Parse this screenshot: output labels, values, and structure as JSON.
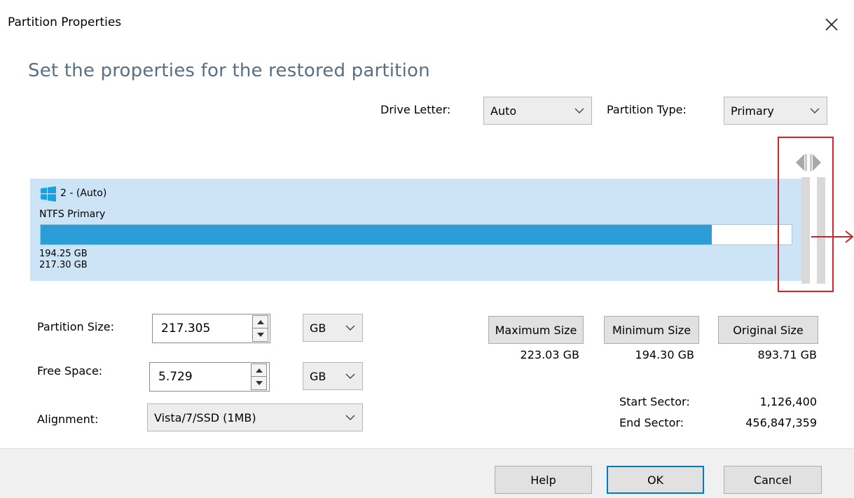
{
  "window": {
    "title": "Partition Properties",
    "close_label": "×"
  },
  "heading": "Set the properties for the restored partition",
  "drive_letter": {
    "label": "Drive Letter:",
    "value": "Auto"
  },
  "partition_type": {
    "label": "Partition Type:",
    "value": "Primary"
  },
  "partition": {
    "name": "2 -  (Auto)",
    "fs": "NTFS Primary",
    "used": "194.25 GB",
    "total": "217.30 GB",
    "used_fraction": 0.894
  },
  "fields": {
    "partition_size": {
      "label": "Partition Size:",
      "value": "217.305",
      "unit": "GB"
    },
    "free_space": {
      "label": "Free Space:",
      "value": "5.729",
      "unit": "GB"
    },
    "alignment": {
      "label": "Alignment:",
      "value": "Vista/7/SSD (1MB)"
    }
  },
  "size_buttons": {
    "maximum": {
      "label": "Maximum Size",
      "value": "223.03 GB"
    },
    "minimum": {
      "label": "Minimum Size",
      "value": "194.30 GB"
    },
    "original": {
      "label": "Original Size",
      "value": "893.71 GB"
    }
  },
  "sectors": {
    "start_label": "Start Sector:",
    "start_value": "1,126,400",
    "end_label": "End Sector:",
    "end_value": "456,847,359"
  },
  "footer": {
    "help": "Help",
    "ok": "OK",
    "cancel": "Cancel"
  },
  "colors": {
    "accent": "#0078d7",
    "bar_fill": "#2b9ed8",
    "panel": "#cde4f7",
    "highlight": "#d2222b"
  },
  "icons": {
    "close": "close-icon",
    "windows": "windows-logo-icon",
    "caret": "chevron-down-icon"
  }
}
